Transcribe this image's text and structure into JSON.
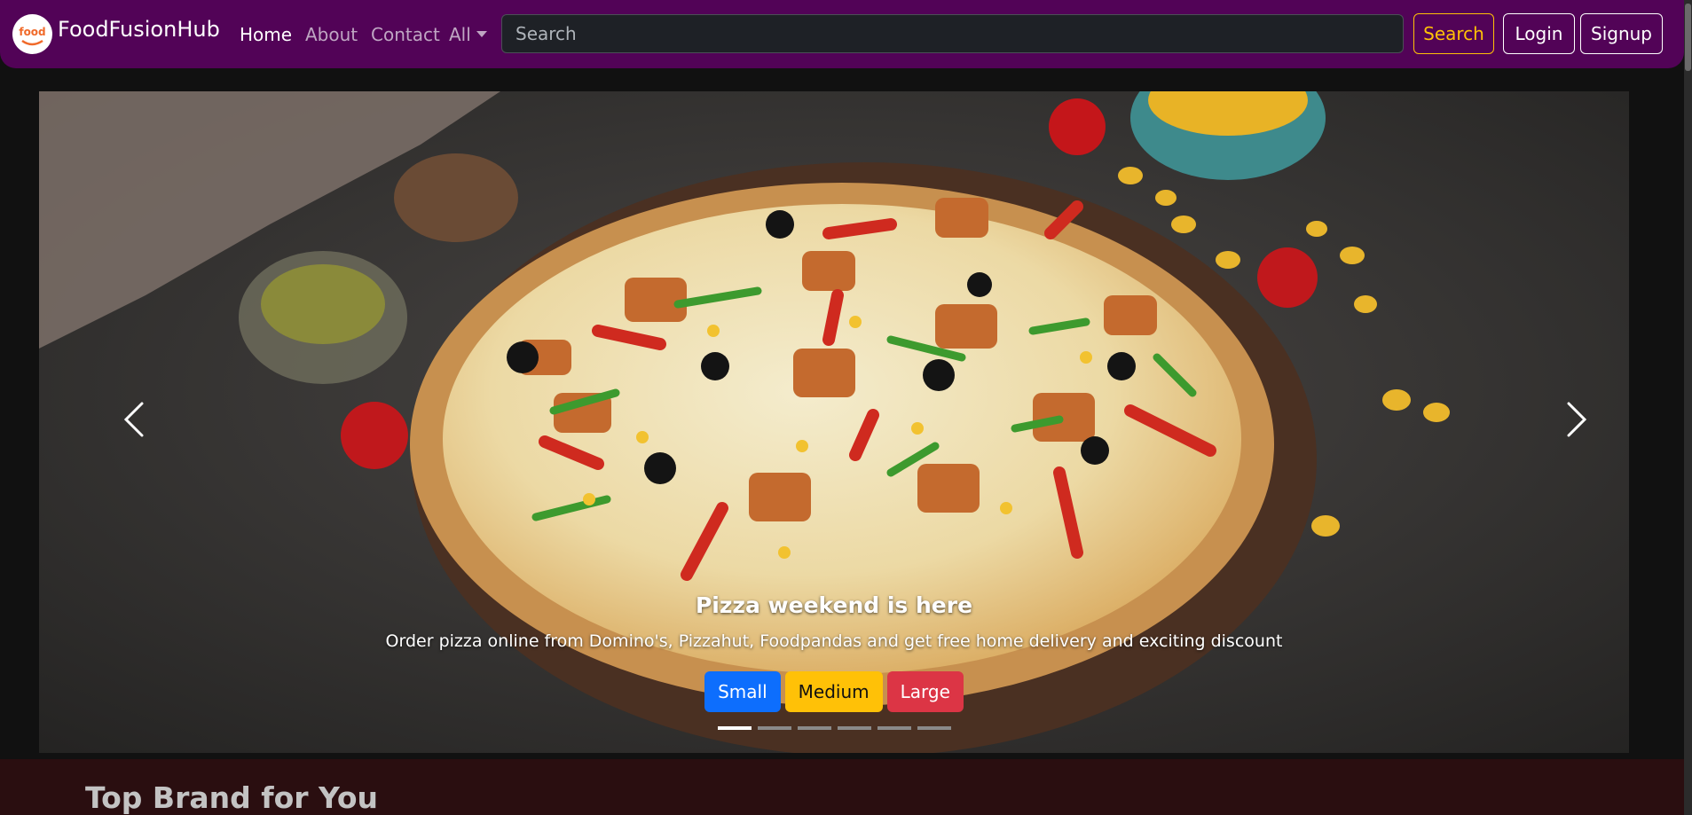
{
  "navbar": {
    "brand": "FoodFusionHub",
    "logo_text": "food",
    "links": [
      "Home",
      "About",
      "Contact"
    ],
    "dropdown_label": "All",
    "search_placeholder": "Search",
    "search_button": "Search",
    "login_button": "Login",
    "signup_button": "Signup"
  },
  "carousel": {
    "title": "Pizza weekend is here",
    "text": "Order pizza online from Domino's, Pizzahut, Foodpandas and get free home delivery and exciting discount",
    "size_buttons": [
      "Small",
      "Medium",
      "Large"
    ],
    "slide_count": 6,
    "active_slide": 1,
    "prev_icon": "chevron-left-icon",
    "next_icon": "chevron-right-icon"
  },
  "section": {
    "heading": "Top Brand for You"
  },
  "colors": {
    "navbar_bg": "#520357",
    "search_accent": "#ffc107",
    "small": "#0d6efd",
    "medium": "#ffc107",
    "large": "#dc3545",
    "section_bg": "#2a0e10"
  }
}
